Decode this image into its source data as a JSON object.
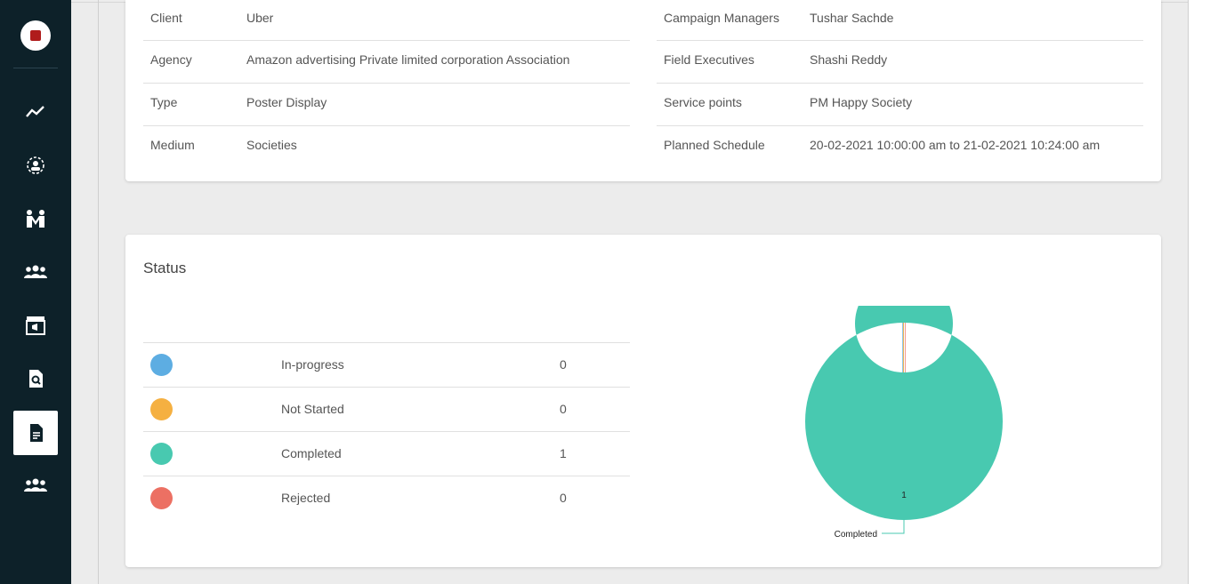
{
  "details": {
    "left": [
      {
        "key": "Client",
        "value": "Uber"
      },
      {
        "key": "Agency",
        "value": "Amazon advertising Private limited corporation Association"
      },
      {
        "key": "Type",
        "value": "Poster Display"
      },
      {
        "key": "Medium",
        "value": "Societies"
      }
    ],
    "right": [
      {
        "key": "Campaign Managers",
        "value": "Tushar Sachde"
      },
      {
        "key": "Field Executives",
        "value": "Shashi Reddy"
      },
      {
        "key": "Service points",
        "value": "PM Happy Society"
      },
      {
        "key": "Planned Schedule",
        "value": "20-02-2021 10:00:00 am to 21-02-2021 10:24:00 am"
      }
    ]
  },
  "status": {
    "title": "Status",
    "rows": [
      {
        "label": "In-progress",
        "count": "0",
        "color": "#5dade2"
      },
      {
        "label": "Not Started",
        "count": "0",
        "color": "#f5b041"
      },
      {
        "label": "Completed",
        "count": "1",
        "color": "#48c9b0"
      },
      {
        "label": "Rejected",
        "count": "0",
        "color": "#ec7063"
      }
    ]
  },
  "sidebar": {
    "icons": [
      "analytics-icon",
      "campaign-group-icon",
      "family-icon",
      "users-icon",
      "store-icon",
      "search-document-icon",
      "document-icon",
      "team-icon"
    ],
    "active_index": 6
  },
  "chart_data": {
    "type": "pie",
    "donut": true,
    "categories": [
      "In-progress",
      "Not Started",
      "Completed",
      "Rejected"
    ],
    "values": [
      0,
      0,
      1,
      0
    ],
    "colors": [
      "#5dade2",
      "#f5b041",
      "#48c9b0",
      "#ec7063"
    ],
    "data_labels": [
      {
        "category": "Completed",
        "text": "1"
      }
    ],
    "slice_labels": [
      {
        "category": "Completed",
        "text": "Completed"
      }
    ]
  }
}
